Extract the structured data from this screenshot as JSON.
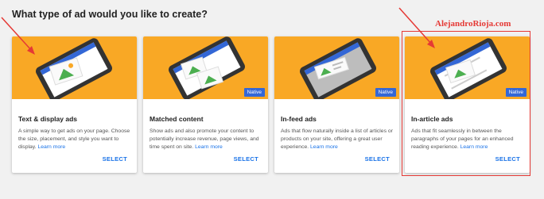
{
  "page": {
    "title": "What type of ad would you like to create?"
  },
  "watermark": "AlejandroRioja.com",
  "cards": [
    {
      "title": "Text & display ads",
      "desc": "A simple way to get ads on your page. Choose the size, placement, and style you want to display.",
      "learn_more": "Learn more",
      "select": "SELECT",
      "badge": ""
    },
    {
      "title": "Matched content",
      "desc": "Show ads and also promote your content to potentially increase revenue, page views, and time spent on site.",
      "learn_more": "Learn more",
      "select": "SELECT",
      "badge": "Native"
    },
    {
      "title": "In-feed ads",
      "desc": "Ads that flow naturally inside a list of articles or products on your site, offering a great user experience.",
      "learn_more": "Learn more",
      "select": "SELECT",
      "badge": "Native"
    },
    {
      "title": "In-article ads",
      "desc": "Ads that fit seamlessly in between the paragraphs of your pages for an enhanced reading experience.",
      "learn_more": "Learn more",
      "select": "SELECT",
      "badge": "Native"
    }
  ],
  "colors": {
    "hero": "#f9a825",
    "accent": "#1a73e8",
    "badge": "#3367d6",
    "annotation": "#e53935"
  }
}
